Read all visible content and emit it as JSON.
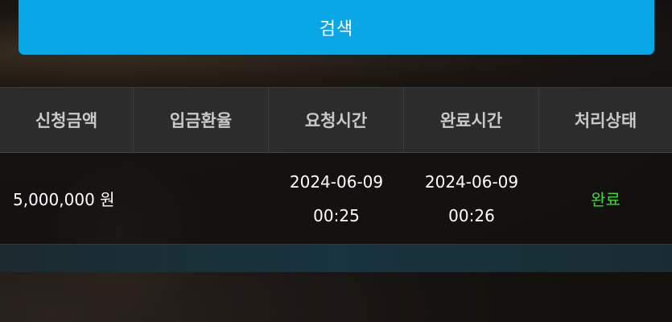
{
  "search_button": {
    "label": "검색"
  },
  "table": {
    "headers": [
      "신청금액",
      "입금환율",
      "요청시간",
      "완료시간",
      "처리상태"
    ],
    "rows": [
      {
        "amount": "5,000,000 원",
        "rate": "",
        "request_date": "2024-06-09",
        "request_time": "00:25",
        "complete_date": "2024-06-09",
        "complete_time": "00:26",
        "status": "완료"
      }
    ]
  },
  "colors": {
    "accent": "#0aa7e6",
    "status_complete": "#3fd83a",
    "header_bg": "#2c2c2c"
  }
}
